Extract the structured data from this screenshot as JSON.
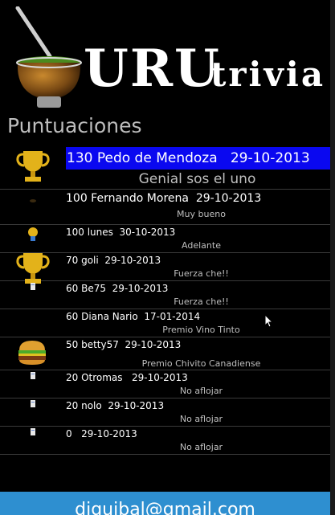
{
  "app": {
    "logo_uru": "URU",
    "logo_trivia": "trivia"
  },
  "section_title": "Puntuaciones",
  "scores": [
    {
      "text": "130 Pedo de Mendoza   29-10-2013",
      "message": "Genial sos el uno",
      "icon": "trophy-icon"
    },
    {
      "text": "100 Fernando Morena  29-10-2013",
      "message": "Muy bueno",
      "icon": "small-dot-icon"
    },
    {
      "text": "100 lunes  30-10-2013",
      "message": "Adelante",
      "icon": "medal-icon"
    },
    {
      "text": "70 goli  29-10-2013",
      "message": "Fuerza che!!",
      "icon": "trophy-icon"
    },
    {
      "text": "60 Be75  29-10-2013",
      "message": "Fuerza che!!",
      "icon": "small-document-icon"
    },
    {
      "text": "60 Diana Nario  17-01-2014",
      "message": "Premio Vino Tinto",
      "icon": ""
    },
    {
      "text": "50 betty57  29-10-2013",
      "message": "Premio Chivito Canadiense",
      "icon": "burger-icon"
    },
    {
      "text": "20 Otromas   29-10-2013",
      "message": "No aflojar",
      "icon": "small-document-icon"
    },
    {
      "text": "20 nolo  29-10-2013",
      "message": "No aflojar",
      "icon": "small-document-icon"
    },
    {
      "text": "0   29-10-2013",
      "message": "No aflojar",
      "icon": "small-document-icon"
    }
  ],
  "footer": {
    "email": "diguibal@gmail.com"
  },
  "colors": {
    "highlight": "#0a08f0",
    "footer": "#2e8fd0"
  }
}
